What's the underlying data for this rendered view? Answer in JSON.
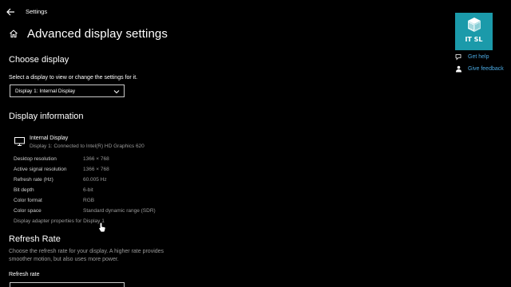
{
  "window": {
    "app_title": "Settings"
  },
  "page": {
    "title": "Advanced display settings"
  },
  "choose_display": {
    "heading": "Choose display",
    "description": "Select a display to view or change the settings for it.",
    "dropdown_value": "Display 1: Internal Display"
  },
  "display_info": {
    "heading": "Display information",
    "name": "Internal Display",
    "connection": "Display 1: Connected to Intel(R) HD Graphics 620",
    "properties": [
      {
        "label": "Desktop resolution",
        "value": "1366 × 768"
      },
      {
        "label": "Active signal resolution",
        "value": "1366 × 768"
      },
      {
        "label": "Refresh rate (Hz)",
        "value": "60.005 Hz"
      },
      {
        "label": "Bit depth",
        "value": "6-bit"
      },
      {
        "label": "Color format",
        "value": "RGB"
      },
      {
        "label": "Color space",
        "value": "Standard dynamic range (SDR)"
      }
    ],
    "adapter_link": "Display adapter properties for Display 1"
  },
  "refresh_rate": {
    "heading": "Refresh Rate",
    "description": "Choose the refresh rate for your display. A higher rate provides smoother motion, but also uses more power.",
    "field_label": "Refresh rate"
  },
  "sidebar": {
    "logo_text": "IT SL",
    "get_help": "Get help",
    "give_feedback": "Give feedback"
  },
  "colors": {
    "background": "#000000",
    "link": "#4aa8e0",
    "logo": "#1b9aaa",
    "muted_text": "#9a9a9a"
  }
}
